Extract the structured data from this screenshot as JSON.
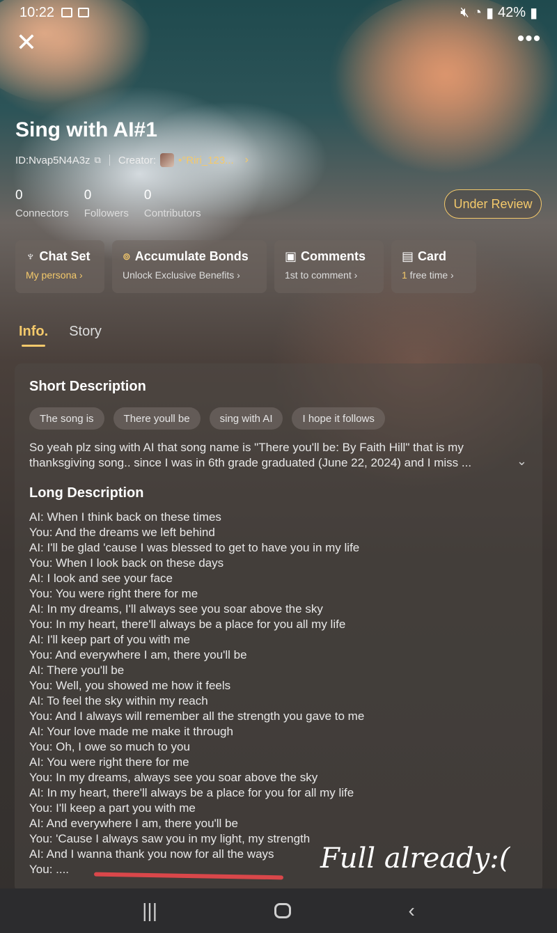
{
  "status_bar": {
    "time": "10:22",
    "battery": "42%"
  },
  "header": {
    "title": "Sing with AI#1",
    "id_text": "ID:Nvap5N4A3z",
    "creator_label": "Creator:",
    "creator_name": "•°Riri_123..."
  },
  "stats": [
    {
      "value": "0",
      "label": "Connectors"
    },
    {
      "value": "0",
      "label": "Followers"
    },
    {
      "value": "0",
      "label": "Contributors"
    }
  ],
  "review_button": "Under Review",
  "actions": [
    {
      "title": "Chat Set",
      "subtitle": "My persona",
      "icon": "chat-set-icon"
    },
    {
      "title": "Accumulate Bonds",
      "subtitle": "Unlock Exclusive Benefits",
      "icon": "bonds-icon"
    },
    {
      "title": "Comments",
      "subtitle": "1st to comment",
      "icon": "comments-icon"
    },
    {
      "title": "Card",
      "subtitle": "1 free time",
      "icon": "card-icon"
    }
  ],
  "tabs": [
    {
      "label": "Info."
    },
    {
      "label": "Story"
    }
  ],
  "short_description": {
    "heading": "Short Description",
    "tags": [
      "The song is",
      "There youll be",
      "sing with AI",
      "I hope it follows"
    ],
    "line1": "So yeah plz sing with AI that song name is \"There you'll be: By Faith Hill\" that is my",
    "line2": "thanksgiving song.. since I was in 6th grade graduated (June 22, 2024) and I miss ..."
  },
  "long_description": {
    "heading": "Long Description",
    "lines": [
      "AI: When I think back on these times",
      "You: And the dreams we left behind",
      "AI: I'll be glad 'cause I was blessed to get to have you in my life",
      "You: When I look back on these days",
      "AI: I look and see your face",
      "You: You were right there for me",
      "AI: In my dreams, I'll always see you soar above the sky",
      "You: In my heart, there'll always be a place for you all my life",
      "AI: I'll keep part of you with me",
      "You: And everywhere I am, there you'll be",
      "AI: There you'll be",
      "You: Well, you showed me how it feels",
      "AI: To feel the sky within my reach",
      "You: And I always will remember all the strength you gave to me",
      "AI: Your love made me make it through",
      "You: Oh, I owe so much to you",
      "AI: You were right there for me",
      "You: In my dreams, always see you soar above the sky",
      "AI: In my heart, there'll always be a place for you for all my life",
      "You: I'll keep a part you with me",
      "AI: And everywhere I am, there you'll be",
      "You: 'Cause I always saw you in my light, my strength",
      "AI: And I wanna thank you now for all the ways",
      "You: ...."
    ]
  },
  "annotation": "Full already:(",
  "colors": {
    "accent_gold": "#f4c96b",
    "annotation_line": "#d9474a"
  }
}
